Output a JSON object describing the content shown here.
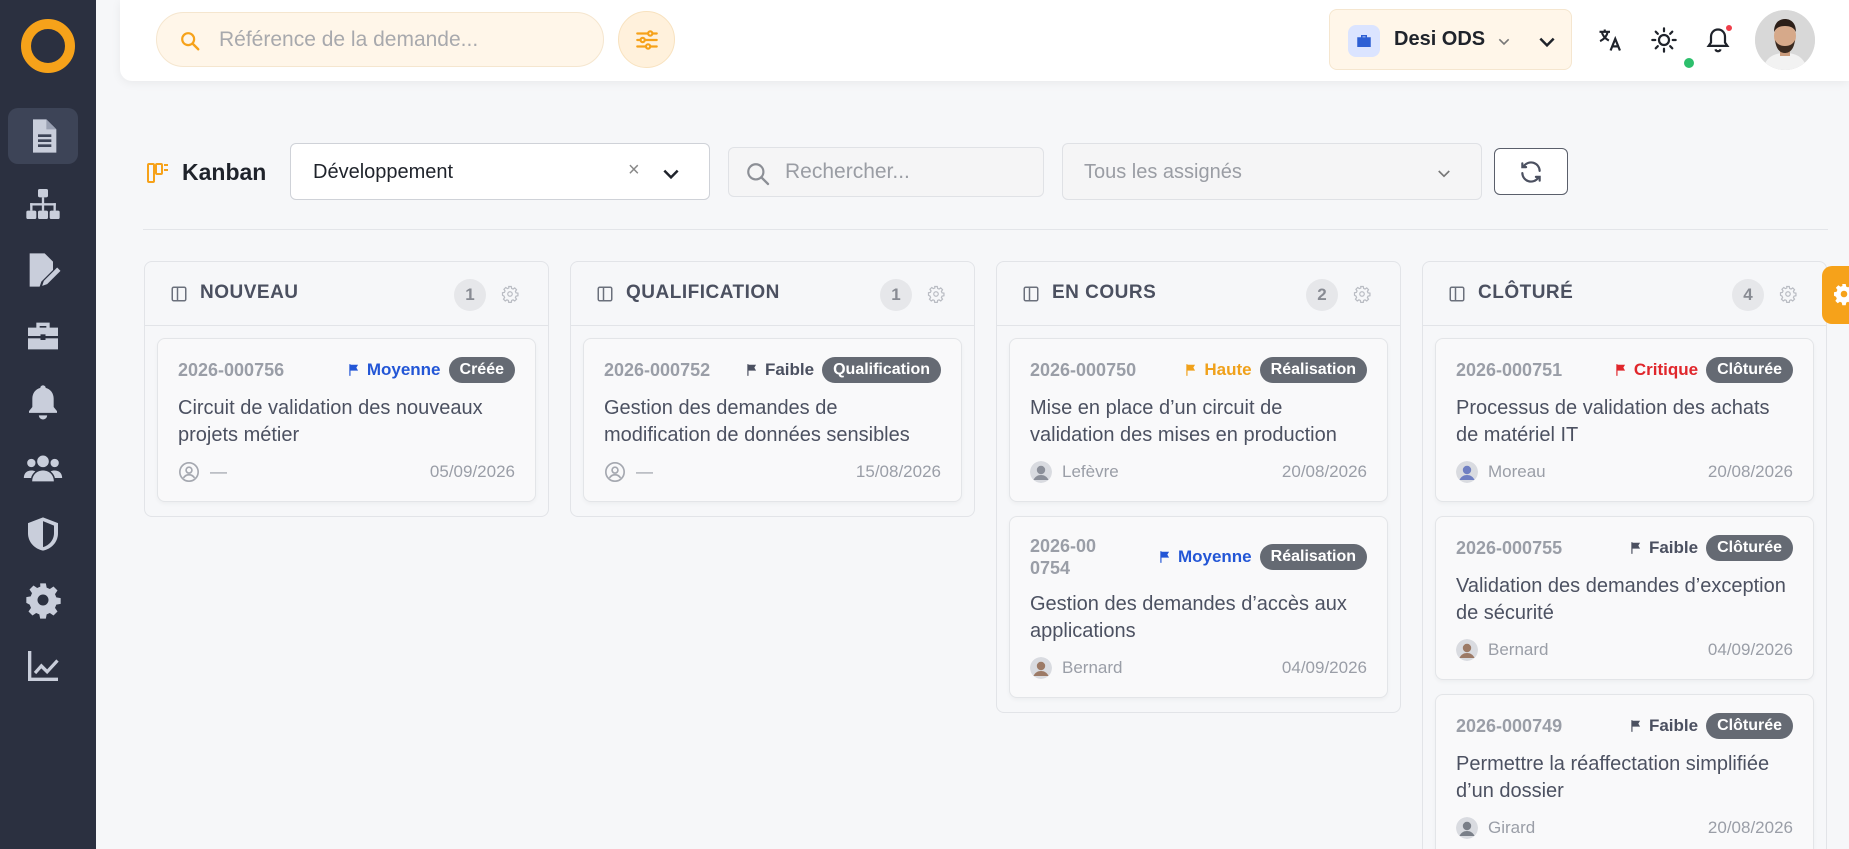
{
  "header": {
    "search_placeholder": "Référence de la demande...",
    "org_name": "Desi ODS"
  },
  "toolbar": {
    "title": "Kanban",
    "project_value": "Développement",
    "project_clear": "×",
    "search_placeholder": "Rechercher...",
    "assignee_value": "Tous les assignés"
  },
  "sidebar": {
    "items": [
      {
        "icon": "document-icon",
        "active": true
      },
      {
        "icon": "sitemap-icon"
      },
      {
        "icon": "file-edit-icon"
      },
      {
        "icon": "briefcase-icon"
      },
      {
        "icon": "bell-icon"
      },
      {
        "icon": "users-icon"
      },
      {
        "icon": "shield-icon"
      },
      {
        "icon": "gear-icon"
      },
      {
        "icon": "chart-line-icon"
      }
    ]
  },
  "colors": {
    "accent": "#f6a21a",
    "prio_moyenne": "#2356d6",
    "prio_faible": "#4b5060",
    "prio_haute": "#f0a11b",
    "prio_critique": "#e0262b"
  },
  "columns": [
    {
      "title": "NOUVEAU",
      "count": "1",
      "cards": [
        {
          "ref": "2026-000756",
          "priority": "Moyenne",
          "status": "Créée",
          "title": "Circuit de validation des nouveaux projets métier",
          "assignee": "—",
          "date": "05/09/2026"
        }
      ]
    },
    {
      "title": "QUALIFICATION",
      "count": "1",
      "cards": [
        {
          "ref": "2026-000752",
          "priority": "Faible",
          "status": "Qualification",
          "title": "Gestion des demandes de modification de données sensibles",
          "assignee": "—",
          "date": "15/08/2026"
        }
      ]
    },
    {
      "title": "EN COURS",
      "count": "2",
      "cards": [
        {
          "ref": "2026-000750",
          "priority": "Haute",
          "status": "Réalisation",
          "title": "Mise en place d’un circuit de validation des mises en production",
          "assignee": "Lefèvre",
          "date": "20/08/2026"
        },
        {
          "ref": "2026-000754",
          "priority": "Moyenne",
          "status": "Réalisation",
          "title": "Gestion des demandes d’accès aux applications",
          "assignee": "Bernard",
          "date": "04/09/2026"
        }
      ]
    },
    {
      "title": "CLÔTURÉ",
      "count": "4",
      "cards": [
        {
          "ref": "2026-000751",
          "priority": "Critique",
          "status": "Clôturée",
          "title": "Processus de validation des achats de matériel IT",
          "assignee": "Moreau",
          "date": "20/08/2026"
        },
        {
          "ref": "2026-000755",
          "priority": "Faible",
          "status": "Clôturée",
          "title": "Validation des demandes d’exception de sécurité",
          "assignee": "Bernard",
          "date": "04/09/2026"
        },
        {
          "ref": "2026-000749",
          "priority": "Faible",
          "status": "Clôturée",
          "title": "Permettre la réaffectation simplifiée d’un dossier",
          "assignee": "Girard",
          "date": "20/08/2026"
        }
      ]
    }
  ]
}
